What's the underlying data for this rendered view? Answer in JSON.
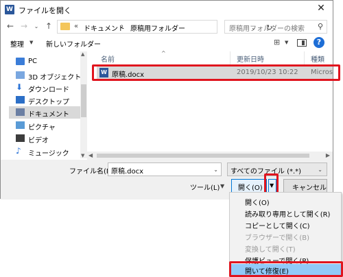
{
  "window": {
    "app_icon_letter": "W",
    "title": "ファイルを開く",
    "close_glyph": "✕"
  },
  "nav": {
    "back_glyph": "←",
    "forward_glyph": "→",
    "history_glyph": "⌄",
    "up_glyph": "↑",
    "breadcrumb_overflow": "«",
    "breadcrumb": [
      "ドキュメント",
      "原稿用フォルダー"
    ],
    "breadcrumb_sep": "›",
    "address_dropdown_glyph": "⌄",
    "refresh_glyph": "↻",
    "search_placeholder": "原稿用フォルダーの検索",
    "search_glyph": "⚲"
  },
  "toolbar": {
    "organize_label": "整理",
    "organize_dropdown": "▼",
    "new_folder_label": "新しいフォルダー",
    "view_glyph": "⊞",
    "view_dropdown": "▼",
    "help_glyph": "?"
  },
  "sidebar": {
    "items": [
      {
        "label": "PC",
        "icon": "pc-icon"
      },
      {
        "label": "3D オブジェクト",
        "icon": "3d-objects-icon"
      },
      {
        "label": "ダウンロード",
        "icon": "download-icon",
        "glyph": "⬇"
      },
      {
        "label": "デスクトップ",
        "icon": "desktop-icon"
      },
      {
        "label": "ドキュメント",
        "icon": "documents-icon",
        "selected": true
      },
      {
        "label": "ピクチャ",
        "icon": "pictures-icon"
      },
      {
        "label": "ビデオ",
        "icon": "videos-icon"
      },
      {
        "label": "ミュージック",
        "icon": "music-icon",
        "glyph": "♪"
      }
    ],
    "scroll_up": "▲",
    "scroll_down": "▼"
  },
  "file_list": {
    "columns": [
      "名前",
      "更新日時",
      "種類"
    ],
    "sort_caret": "^",
    "files": [
      {
        "icon_letter": "W",
        "name": "原稿.docx",
        "modified": "2019/10/23 10:22",
        "type": "Microsoft W"
      }
    ],
    "hscroll_left": "◀",
    "hscroll_right": "▶"
  },
  "bottom": {
    "filename_label": "ファイル名(N):",
    "filename_value": "原稿.docx",
    "filename_dropdown": "⌄",
    "filetype_value": "すべてのファイル (*.*)",
    "filetype_dropdown": "⌄",
    "tools_label": "ツール(L)",
    "tools_dropdown": "▼",
    "open_label": "開く(O)",
    "open_dropdown_glyph": "▼",
    "cancel_label": "キャンセル"
  },
  "menu": {
    "items": [
      {
        "label": "開く(O)",
        "enabled": true
      },
      {
        "label": "読み取り専用として開く(R)",
        "enabled": true
      },
      {
        "label": "コピーとして開く(C)",
        "enabled": true
      },
      {
        "label": "ブラウザーで開く(B)",
        "enabled": false
      },
      {
        "label": "変換して開く(T)",
        "enabled": false
      },
      {
        "label": "保護ビューで開く(P)",
        "enabled": true
      },
      {
        "label": "開いて修復(E)",
        "enabled": true,
        "highlighted": true
      }
    ]
  },
  "colors": {
    "highlight_border": "#e0141e",
    "word_blue": "#2b579a",
    "menu_hover": "#91c9f7"
  }
}
